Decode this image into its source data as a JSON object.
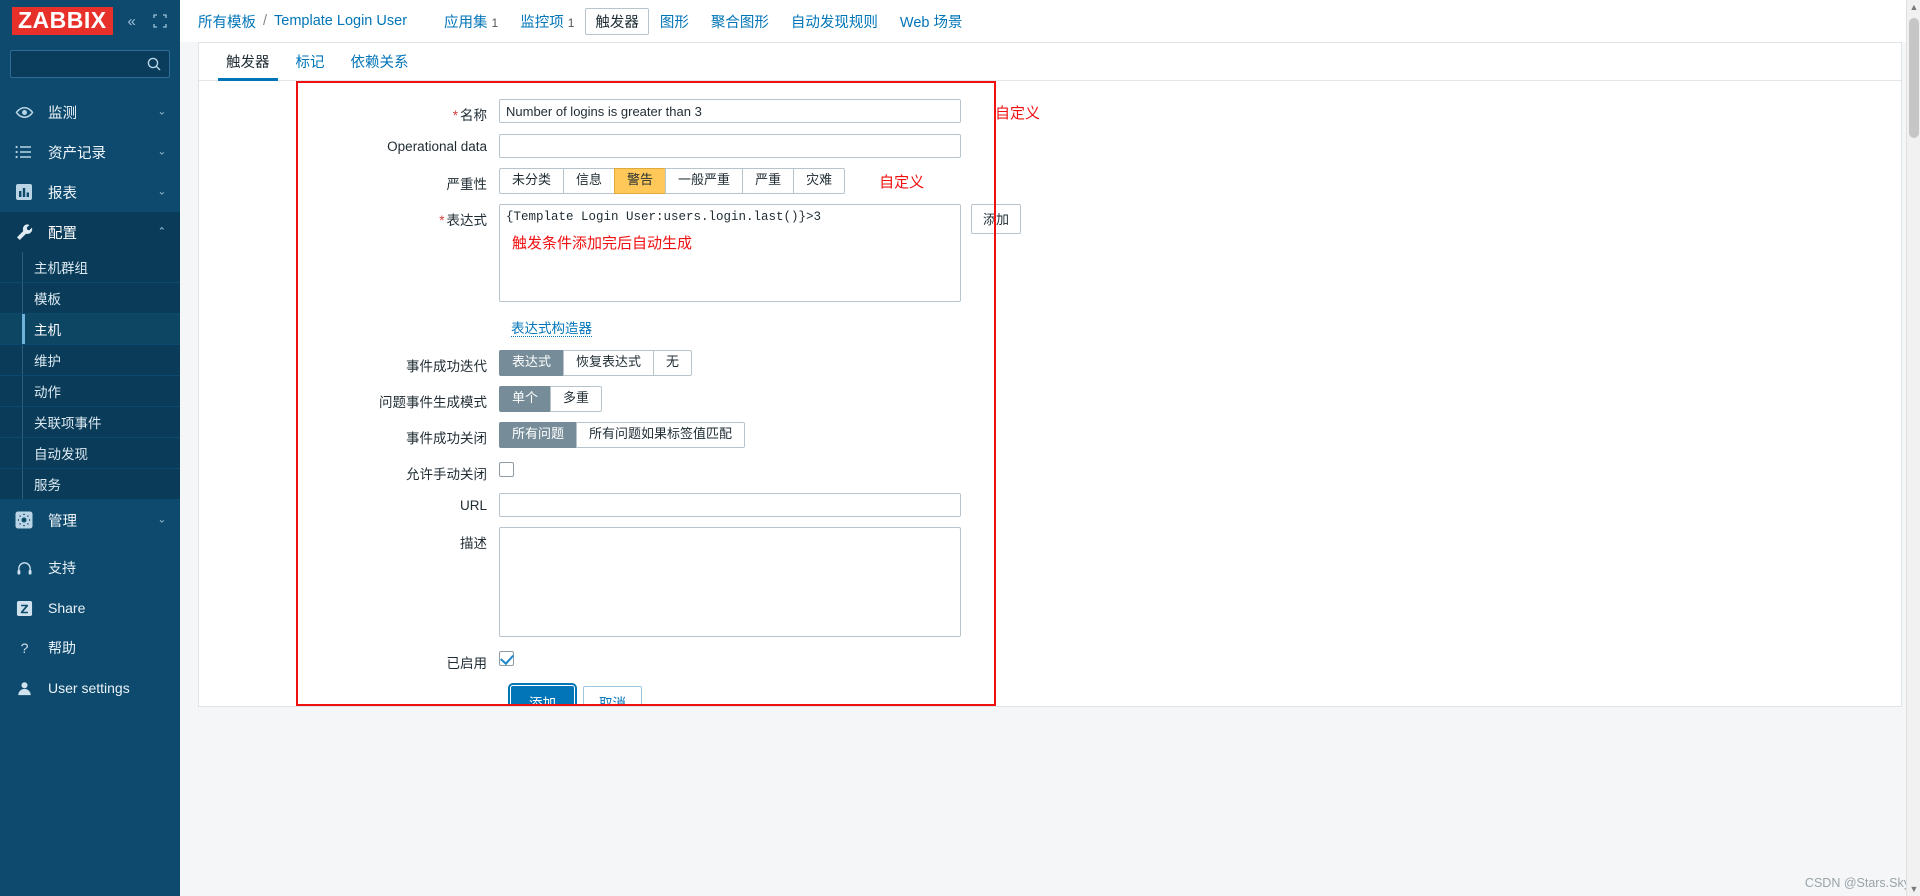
{
  "sidebar": {
    "logo": "ZABBIX",
    "collapse_icon": "chevron-double-left-icon",
    "expand_icon": "expand-icon",
    "search_placeholder": "",
    "search_value": "",
    "nav": [
      {
        "label": "监测",
        "icon": "eye-icon",
        "chevron": "⌄",
        "active": false
      },
      {
        "label": "资产记录",
        "icon": "list-icon",
        "chevron": "⌄",
        "active": false
      },
      {
        "label": "报表",
        "icon": "bar-chart-icon",
        "chevron": "⌄",
        "active": false
      },
      {
        "label": "配置",
        "icon": "wrench-icon",
        "chevron": "⌃",
        "active": true
      }
    ],
    "sub_items": [
      {
        "label": "主机群组",
        "selected": false
      },
      {
        "label": "模板",
        "selected": false
      },
      {
        "label": "主机",
        "selected": true
      },
      {
        "label": "维护",
        "selected": false
      },
      {
        "label": "动作",
        "selected": false
      },
      {
        "label": "关联项事件",
        "selected": false
      },
      {
        "label": "自动发现",
        "selected": false
      },
      {
        "label": "服务",
        "selected": false
      }
    ],
    "admin": {
      "label": "管理",
      "icon": "gear-icon",
      "chevron": "⌄"
    },
    "bottom": [
      {
        "label": "支持",
        "icon": "headset-icon"
      },
      {
        "label": "Share",
        "icon": "zabbix-share-icon"
      },
      {
        "label": "帮助",
        "icon": "question-icon"
      },
      {
        "label": "User settings",
        "icon": "user-icon"
      }
    ]
  },
  "breadcrumb": {
    "root": "所有模板",
    "separator": "/",
    "current": "Template Login User"
  },
  "topmenu": [
    {
      "label": "应用集",
      "count": "1",
      "current": false
    },
    {
      "label": "监控项",
      "count": "1",
      "current": false
    },
    {
      "label": "触发器",
      "count": "",
      "current": true
    },
    {
      "label": "图形",
      "count": "",
      "current": false
    },
    {
      "label": "聚合图形",
      "count": "",
      "current": false
    },
    {
      "label": "自动发现规则",
      "count": "",
      "current": false
    },
    {
      "label": "Web 场景",
      "count": "",
      "current": false
    }
  ],
  "tabs": [
    {
      "label": "触发器",
      "active": true
    },
    {
      "label": "标记",
      "active": false
    },
    {
      "label": "依赖关系",
      "active": false
    }
  ],
  "form": {
    "name": {
      "label": "名称",
      "required": true,
      "value": "Number of logins is greater than 3",
      "placeholder": "",
      "annotation": "自定义"
    },
    "operational_data": {
      "label": "Operational data",
      "value": "",
      "placeholder": ""
    },
    "severity": {
      "label": "严重性",
      "options": [
        "未分类",
        "信息",
        "警告",
        "一般严重",
        "严重",
        "灾难"
      ],
      "selected": "警告",
      "annotation": "自定义"
    },
    "expression": {
      "label": "表达式",
      "required": true,
      "value": "{Template Login User:users.login.last()}>3",
      "annotation": "触发条件添加完后自动生成",
      "add_button": "添加",
      "constructor_link": "表达式构造器"
    },
    "event_succeed": {
      "label": "事件成功迭代",
      "options": [
        "表达式",
        "恢复表达式",
        "无"
      ],
      "selected": "表达式"
    },
    "problem_mode": {
      "label": "问题事件生成模式",
      "options": [
        "单个",
        "多重"
      ],
      "selected": "单个"
    },
    "close_mode": {
      "label": "事件成功关闭",
      "options": [
        "所有问题",
        "所有问题如果标签值匹配"
      ],
      "selected": "所有问题"
    },
    "manual_close": {
      "label": "允许手动关闭",
      "checked": false
    },
    "url": {
      "label": "URL",
      "value": "",
      "placeholder": ""
    },
    "description": {
      "label": "描述",
      "value": "",
      "placeholder": ""
    },
    "enabled": {
      "label": "已启用",
      "checked": true
    },
    "submit_button": "添加",
    "cancel_button": "取消"
  },
  "watermark": "CSDN @Stars.Sky",
  "colors": {
    "sidebar_bg": "#0e4a6e",
    "logo_red": "#e8302b",
    "link_blue": "#0275b8",
    "warning_amber": "#ffc859",
    "segment_grey": "#768d99",
    "annotation_red": "#f01010"
  }
}
